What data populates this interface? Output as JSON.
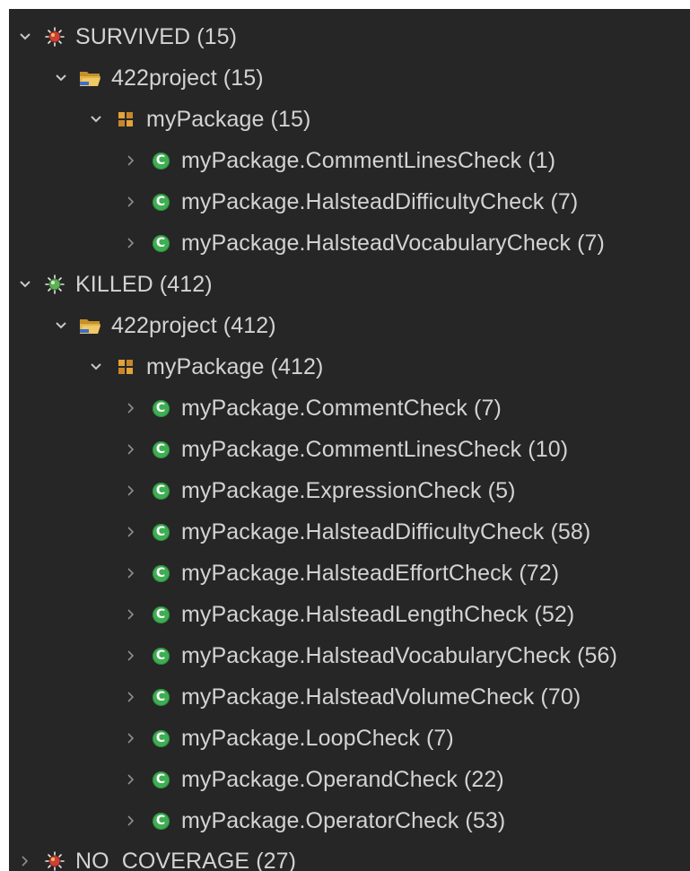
{
  "colors": {
    "panel_bg": "#262626",
    "text": "#d3d3d3",
    "chevron": "#c8c8c8",
    "bug_survived": "#c8413a",
    "bug_killed": "#5fae58",
    "bug_no_coverage": "#c8413a",
    "folder": "#e0b248",
    "package": "#e2a33a",
    "class_icon": "#3fae53"
  },
  "tree": [
    {
      "label": "SURVIVED (15)",
      "icon": "survived-bug-icon",
      "expanded": true
    },
    {
      "label": "422project (15)",
      "icon": "project-folder-icon",
      "expanded": true
    },
    {
      "label": "myPackage (15)",
      "icon": "package-icon",
      "expanded": true
    },
    {
      "label": "myPackage.CommentLinesCheck (1)",
      "icon": "class-icon",
      "expanded": false
    },
    {
      "label": "myPackage.HalsteadDifficultyCheck (7)",
      "icon": "class-icon",
      "expanded": false
    },
    {
      "label": "myPackage.HalsteadVocabularyCheck (7)",
      "icon": "class-icon",
      "expanded": false
    },
    {
      "label": "KILLED (412)",
      "icon": "killed-bug-icon",
      "expanded": true
    },
    {
      "label": "422project (412)",
      "icon": "project-folder-icon",
      "expanded": true
    },
    {
      "label": "myPackage (412)",
      "icon": "package-icon",
      "expanded": true
    },
    {
      "label": "myPackage.CommentCheck (7)",
      "icon": "class-icon",
      "expanded": false
    },
    {
      "label": "myPackage.CommentLinesCheck (10)",
      "icon": "class-icon",
      "expanded": false
    },
    {
      "label": "myPackage.ExpressionCheck (5)",
      "icon": "class-icon",
      "expanded": false
    },
    {
      "label": "myPackage.HalsteadDifficultyCheck (58)",
      "icon": "class-icon",
      "expanded": false
    },
    {
      "label": "myPackage.HalsteadEffortCheck (72)",
      "icon": "class-icon",
      "expanded": false
    },
    {
      "label": "myPackage.HalsteadLengthCheck (52)",
      "icon": "class-icon",
      "expanded": false
    },
    {
      "label": "myPackage.HalsteadVocabularyCheck (56)",
      "icon": "class-icon",
      "expanded": false
    },
    {
      "label": "myPackage.HalsteadVolumeCheck (70)",
      "icon": "class-icon",
      "expanded": false
    },
    {
      "label": "myPackage.LoopCheck (7)",
      "icon": "class-icon",
      "expanded": false
    },
    {
      "label": "myPackage.OperandCheck (22)",
      "icon": "class-icon",
      "expanded": false
    },
    {
      "label": "myPackage.OperatorCheck (53)",
      "icon": "class-icon",
      "expanded": false
    },
    {
      "label": "NO_COVERAGE (27)",
      "icon": "no-coverage-bug-icon",
      "expanded": false
    }
  ],
  "class_icon_letter": "C"
}
